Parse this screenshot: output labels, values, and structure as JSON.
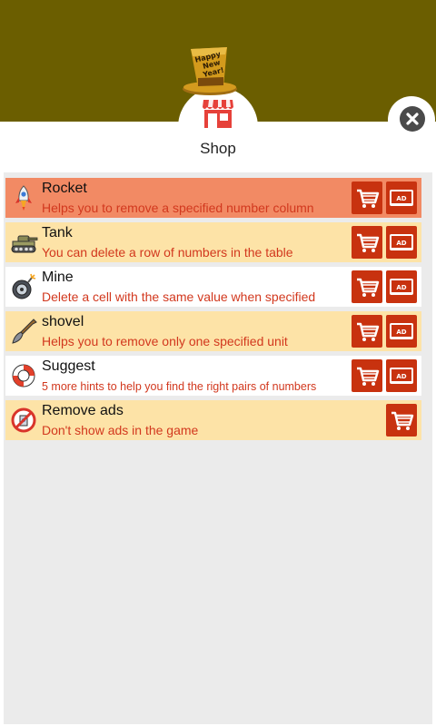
{
  "header": {
    "title": "Shop",
    "hat_text": [
      "Happy",
      "New",
      "Year!"
    ]
  },
  "colors": {
    "header_bg": "#6b5e00",
    "row_selected": "#f28a64",
    "row_highlight": "#fde3a7",
    "row_plain": "#ffffff",
    "button_red": "#c8320f",
    "desc_red": "#d2381e"
  },
  "items": [
    {
      "name": "Rocket",
      "desc": "Helps you to remove a specified number column",
      "icon": "rocket-icon"
    },
    {
      "name": "Tank",
      "desc": "You can delete a row of numbers in the table",
      "icon": "tank-icon"
    },
    {
      "name": "Mine",
      "desc": "Delete a cell with the same value when specified",
      "icon": "mine-icon"
    },
    {
      "name": "shovel",
      "desc": "Helps you to remove only one specified unit",
      "icon": "shovel-icon"
    },
    {
      "name": "Suggest",
      "desc": "5 more hints to help you find the right pairs of numbers",
      "icon": "lifebuoy-icon"
    },
    {
      "name": "Remove ads",
      "desc": "Don't show ads in the game",
      "icon": "no-ads-icon"
    }
  ],
  "ad_label": "AD"
}
